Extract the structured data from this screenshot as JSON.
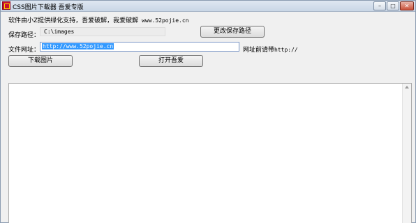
{
  "window": {
    "title": "CSS图片下载器 吾爱专版",
    "icon": "app-logo-icon",
    "controls": {
      "minimize": "–",
      "maximize": "□",
      "close": "✕"
    }
  },
  "info": {
    "text_zh": "软件由小Z提供绿化支持，吾爱破解，我爱破解",
    "url": "www.52pojie.cn"
  },
  "save_path": {
    "label": "保存路径：",
    "value": "C:\\images",
    "change_button": "更改保存路径"
  },
  "file_url": {
    "label": "文件网址：",
    "value": "http://www.52pojie.cn",
    "hint_zh": "网址前请带",
    "hint_prefix": "http://"
  },
  "actions": {
    "download_button": "下载图片",
    "open_button": "打开吾爱"
  },
  "output": {
    "content": ""
  }
}
